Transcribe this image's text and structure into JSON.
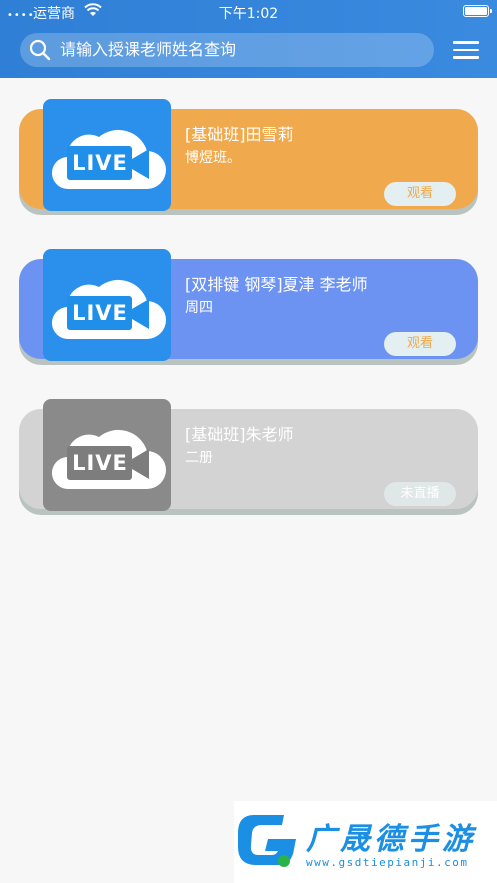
{
  "status_bar": {
    "signal": "••••",
    "carrier": "运营商",
    "time": "下午1:02"
  },
  "search": {
    "placeholder": "请输入授课老师姓名查询"
  },
  "courses": [
    {
      "title": "[基础班]田雪莉",
      "subtitle": "博煜班。",
      "action": "观看",
      "thumb_label": "LIVE",
      "color": "#f0a94d"
    },
    {
      "title": "[双排键 钢琴]夏津 李老师",
      "subtitle": "周四",
      "action": "观看",
      "thumb_label": "LIVE",
      "color": "#6d93f2"
    },
    {
      "title": "[基础班]朱老师",
      "subtitle": "二册",
      "action": "未直播",
      "thumb_label": "LIVE",
      "color": "#d3d3d3"
    }
  ],
  "colors": {
    "header": "#3284dc",
    "watch_text": "#f0a94d",
    "watch_bg": "#e3eff0",
    "live_blue": "#1f8fea",
    "live_gray": "#7d7d7d"
  },
  "watermark": {
    "name": "广晟德手游",
    "url": "www.gsdtiepianji.com"
  }
}
